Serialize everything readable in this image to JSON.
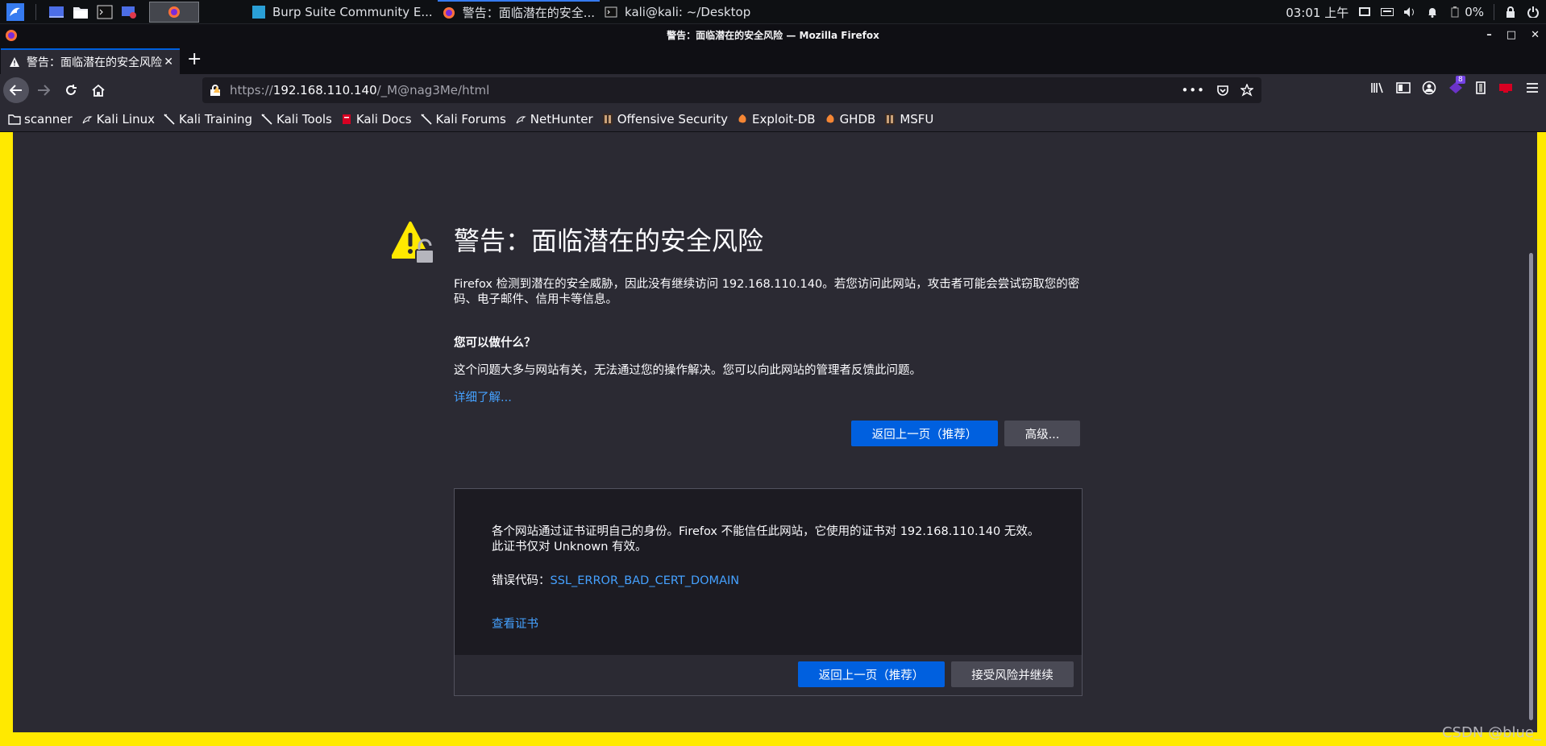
{
  "taskbar": {
    "windows": [
      {
        "label": "Burp Suite Community E..."
      },
      {
        "label": "警告：面临潜在的安全..."
      },
      {
        "label": "kali@kali: ~/Desktop"
      }
    ],
    "clock": "03:01 上午",
    "battery": "0%"
  },
  "firefox": {
    "window_title": "警告：面临潜在的安全风险 — Mozilla Firefox",
    "tab_title": "警告：面临潜在的安全风险",
    "url_scheme": "https://",
    "url_host": "192.168.110.140",
    "url_path": "/_M@nag3Me/html",
    "extension_badge": "8",
    "bookmarks": [
      {
        "label": "scanner",
        "icon": "folder-icon"
      },
      {
        "label": "Kali Linux",
        "icon": "kali-icon"
      },
      {
        "label": "Kali Training",
        "icon": "kali-icon"
      },
      {
        "label": "Kali Tools",
        "icon": "kali-icon"
      },
      {
        "label": "Kali Docs",
        "icon": "kali-docs-icon"
      },
      {
        "label": "Kali Forums",
        "icon": "kali-icon"
      },
      {
        "label": "NetHunter",
        "icon": "kali-icon"
      },
      {
        "label": "Offensive Security",
        "icon": "offsec-icon"
      },
      {
        "label": "Exploit-DB",
        "icon": "exploitdb-icon"
      },
      {
        "label": "GHDB",
        "icon": "exploitdb-icon"
      },
      {
        "label": "MSFU",
        "icon": "offsec-icon"
      }
    ]
  },
  "error_page": {
    "title": "警告：面临潜在的安全风险",
    "description": "Firefox 检测到潜在的安全威胁，因此没有继续访问 192.168.110.140。若您访问此网站，攻击者可能会尝试窃取您的密码、电子邮件、信用卡等信息。",
    "what_can_you_do": "您可以做什么？",
    "advice": "这个问题大多与网站有关，无法通过您的操作解决。您可以向此网站的管理者反馈此问题。",
    "learn_more": "详细了解...",
    "go_back_label": "返回上一页（推荐）",
    "advanced_label": "高级...",
    "advanced": {
      "text": "各个网站通过证书证明自己的身份。Firefox 不能信任此网站，它使用的证书对 192.168.110.140 无效。此证书仅对 Unknown 有效。",
      "error_code_label": "错误代码：",
      "error_code": "SSL_ERROR_BAD_CERT_DOMAIN",
      "view_certificate": "查看证书",
      "go_back_label": "返回上一页（推荐）",
      "accept_label": "接受风险并继续"
    }
  },
  "watermark": "CSDN @blue_",
  "colors": {
    "primary_button": "#0060df",
    "link": "#45a1ff",
    "warning_border": "#ffe900",
    "page_background": "#2b2a33"
  }
}
